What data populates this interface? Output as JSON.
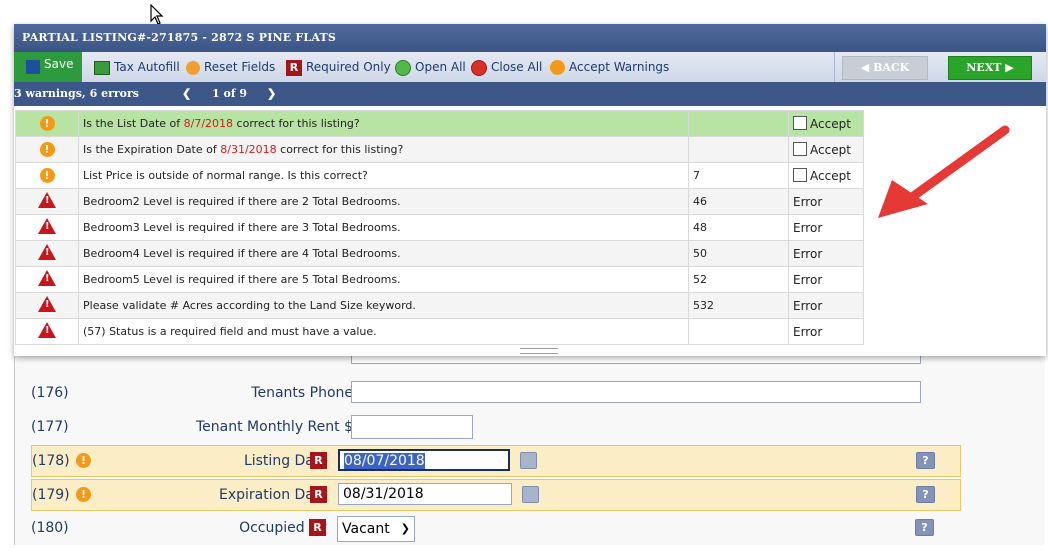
{
  "panel": {
    "title": "PARTIAL LISTING#-271875 - 2872 S PINE FLATS",
    "toolbar": {
      "save": "Save",
      "tax_autofill": "Tax Autofill",
      "reset_fields": "Reset Fields",
      "required_only": "Required Only",
      "open_all": "Open All",
      "close_all": "Close All",
      "accept_warnings": "Accept Warnings",
      "back": "BACK",
      "next": "NEXT",
      "r_badge": "R"
    },
    "status": {
      "summary": "3 warnings, 6 errors",
      "page": "1 of 9",
      "prev": "❮",
      "next": "❯"
    },
    "rows": [
      {
        "type": "warning",
        "pre": "Is the List Date of ",
        "date": "8/7/2018",
        "post": " correct for this listing?",
        "code": "",
        "action": "Accept"
      },
      {
        "type": "warning",
        "pre": "Is the Expiration Date of ",
        "date": "8/31/2018",
        "post": " correct for this listing?",
        "code": "",
        "action": "Accept"
      },
      {
        "type": "warning",
        "pre": "List Price is outside of normal range. Is this correct?",
        "date": "",
        "post": "",
        "code": "7",
        "action": "Accept"
      },
      {
        "type": "error",
        "pre": "Bedroom2 Level is required if there are 2 Total Bedrooms.",
        "date": "",
        "post": "",
        "code": "46",
        "action": "Error"
      },
      {
        "type": "error",
        "pre": "Bedroom3 Level is required if there are 3 Total Bedrooms.",
        "date": "",
        "post": "",
        "code": "48",
        "action": "Error"
      },
      {
        "type": "error",
        "pre": "Bedroom4 Level is required if there are 4 Total Bedrooms.",
        "date": "",
        "post": "",
        "code": "50",
        "action": "Error"
      },
      {
        "type": "error",
        "pre": "Bedroom5 Level is required if there are 5 Total Bedrooms.",
        "date": "",
        "post": "",
        "code": "52",
        "action": "Error"
      },
      {
        "type": "error",
        "pre": "Please validate # Acres according to the Land Size keyword.",
        "date": "",
        "post": "",
        "code": "532",
        "action": "Error"
      },
      {
        "type": "error",
        "pre": "(57) Status is a required field and must have a value.",
        "date": "",
        "post": "",
        "code": "",
        "action": "Error"
      }
    ]
  },
  "form": {
    "rows": [
      {
        "num": "(176)",
        "label": "Tenants Phone",
        "value": ""
      },
      {
        "num": "(177)",
        "label": "Tenant Monthly Rent $",
        "value": ""
      },
      {
        "num": "(178)",
        "label": "Listing Date",
        "value": "08/07/2018"
      },
      {
        "num": "(179)",
        "label": "Expiration Date",
        "value": "08/31/2018"
      },
      {
        "num": "(180)",
        "label": "Occupied By",
        "value": "Vacant"
      }
    ],
    "r": "R",
    "q": "?",
    "warn": "!"
  },
  "colors": {
    "titlebar": "#3a5585",
    "selected_row": "#b7e3a3",
    "error_icon": "#c8151b",
    "warning_icon": "#f29a17",
    "next_button": "#2aa52a",
    "annotation_arrow": "#e53935"
  }
}
